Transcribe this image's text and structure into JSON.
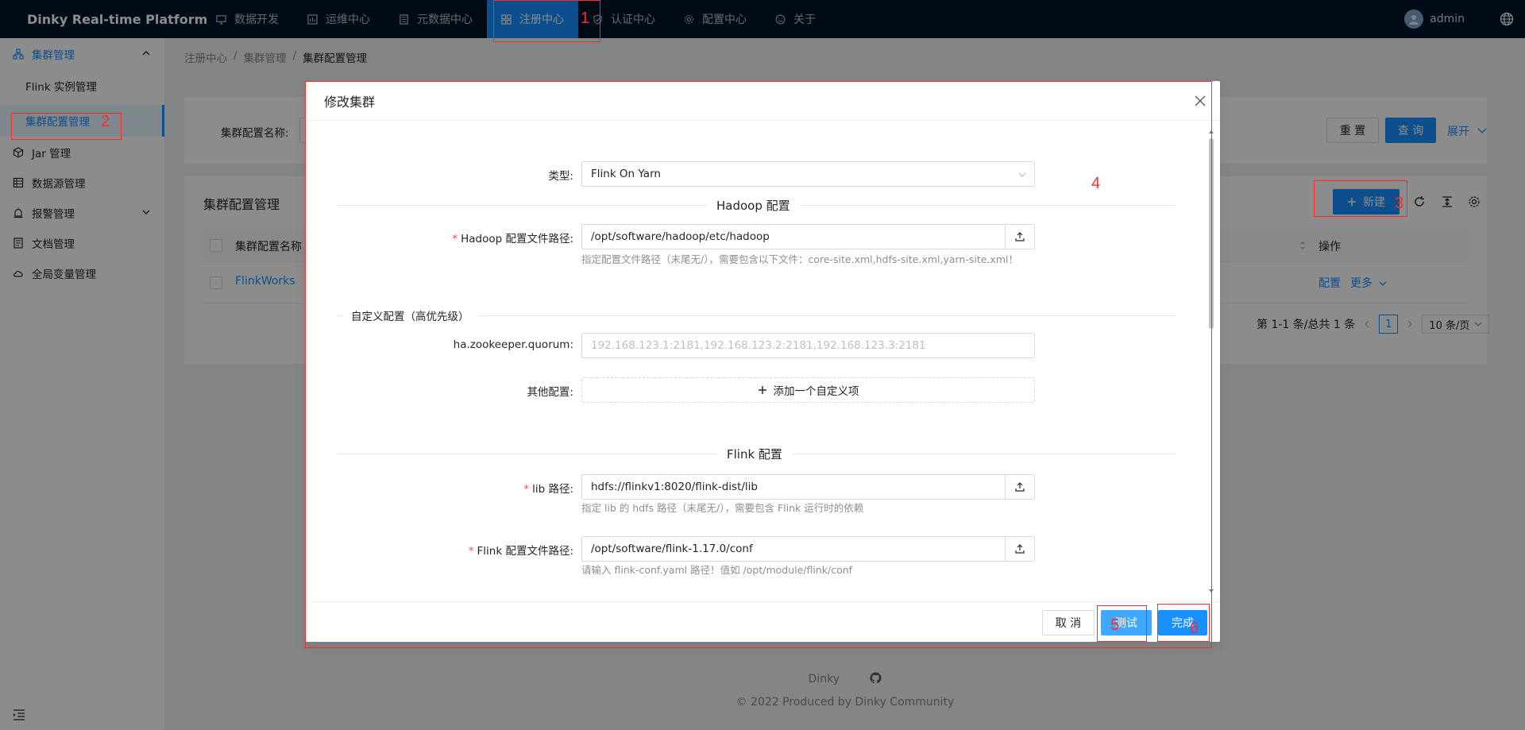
{
  "app": {
    "title": "Dinky Real-time Platform",
    "accent_color": "#1890ff",
    "header_color": "#001529"
  },
  "nav": {
    "items": [
      {
        "label": "数据开发",
        "icon": "monitor-icon"
      },
      {
        "label": "运维中心",
        "icon": "dashboard-icon"
      },
      {
        "label": "元数据中心",
        "icon": "database-icon"
      },
      {
        "label": "注册中心",
        "icon": "appstore-icon"
      },
      {
        "label": "认证中心",
        "icon": "safety-icon"
      },
      {
        "label": "配置中心",
        "icon": "setting-icon"
      },
      {
        "label": "关于",
        "icon": "smile-icon"
      }
    ],
    "active_index": 3
  },
  "user": {
    "name": "admin"
  },
  "sidebar": {
    "items": [
      {
        "label": "集群管理"
      },
      {
        "label": "Flink 实例管理"
      },
      {
        "label": "集群配置管理"
      },
      {
        "label": "Jar 管理"
      },
      {
        "label": "数据源管理"
      },
      {
        "label": "报警管理"
      },
      {
        "label": "文档管理"
      },
      {
        "label": "全局变量管理"
      }
    ]
  },
  "breadcrumb": [
    "注册中心",
    "集群管理",
    "集群配置管理"
  ],
  "search": {
    "label": "集群配置名称:",
    "reset": "重 置",
    "query": "查 询",
    "expand": "展开"
  },
  "table": {
    "title": "集群配置管理",
    "new_button": "新建",
    "columns": [
      "集群配置名称",
      "操作"
    ],
    "rows": [
      {
        "name": "FlinkWorks",
        "action_config": "配置",
        "action_more": "更多"
      }
    ],
    "pagination": {
      "summary": "第 1-1 条/总共 1 条",
      "page": "1",
      "page_size": "10 条/页"
    }
  },
  "footer": {
    "brand": "Dinky",
    "copyright": "© 2022 Produced by Dinky Community"
  },
  "modal": {
    "title": "修改集群",
    "type_label": "类型:",
    "type_value": "Flink On Yarn",
    "hadoop_section": "Hadoop 配置",
    "hadoop_path_label": "Hadoop 配置文件路径:",
    "hadoop_path_value": "/opt/software/hadoop/etc/hadoop",
    "hadoop_path_help": "指定配置文件路径（末尾无/），需要包含以下文件：core-site.xml,hdfs-site.xml,yarn-site.xml！",
    "custom_section": "自定义配置（高优先级）",
    "zk_label": "ha.zookeeper.quorum:",
    "zk_placeholder": "192.168.123.1:2181,192.168.123.2:2181,192.168.123.3:2181",
    "other_label": "其他配置:",
    "add_custom": "添加一个自定义项",
    "flink_section": "Flink 配置",
    "lib_label": "lib 路径:",
    "lib_value": "hdfs://flinkv1:8020/flink-dist/lib",
    "lib_help": "指定 lib 的 hdfs 路径（末尾无/），需要包含 Flink 运行时的依赖",
    "flink_conf_label": "Flink 配置文件路径:",
    "flink_conf_value": "/opt/software/flink-1.17.0/conf",
    "flink_conf_help": "请输入 flink-conf.yaml 路径！值如 /opt/module/flink/conf",
    "cancel": "取 消",
    "test": "测试",
    "finish": "完成"
  },
  "annotations": [
    "1",
    "2",
    "3",
    "4",
    "5",
    "6"
  ],
  "annotation_color": "#ff2a2a"
}
